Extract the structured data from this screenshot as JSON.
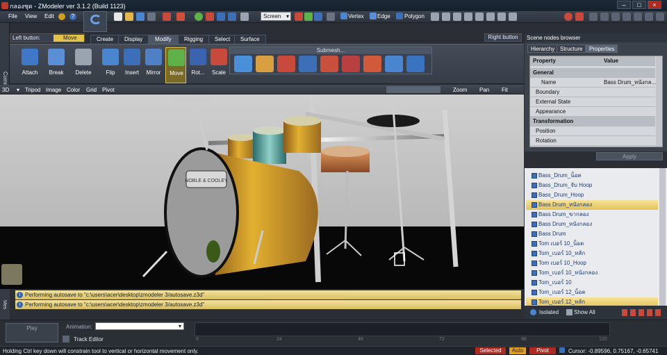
{
  "window": {
    "title": "กลองชุด - ZModeler ver 3.1.2 (Build 1123)",
    "controls": [
      "–",
      "□",
      "×"
    ]
  },
  "menu": [
    "File",
    "View",
    "Edit"
  ],
  "toolbar_top": {
    "screen_select": "Screen",
    "vertex": "Vertex",
    "edge": "Edge",
    "polygon": "Polygon"
  },
  "left_button": {
    "label": "Left button:",
    "value": "Move"
  },
  "right_button": {
    "label": "Right button"
  },
  "tabs": [
    "Create",
    "Display",
    "Modify",
    "Rigging",
    "Select",
    "Surface"
  ],
  "active_tab": "Modify",
  "tools": [
    {
      "label": "Attach",
      "icon": "attach-icon",
      "color": "#3f78c8"
    },
    {
      "label": "Break",
      "icon": "break-icon",
      "color": "#5a8fd6"
    },
    {
      "label": "Delete",
      "icon": "trash-icon",
      "color": "#9aa4b0"
    },
    {
      "label": "Flip",
      "icon": "flip-icon",
      "color": "#4a86d0"
    },
    {
      "label": "Insert",
      "icon": "insert-icon",
      "color": "#3d6fb8"
    },
    {
      "label": "Mirror",
      "icon": "mirror-icon",
      "color": "#4f7fc4"
    },
    {
      "label": "Move",
      "icon": "move-icon",
      "color": "#5fb24a"
    },
    {
      "label": "Rot...",
      "icon": "rotate-icon",
      "color": "#3a64b0"
    },
    {
      "label": "Scale",
      "icon": "scale-icon",
      "color": "#c84a3c"
    }
  ],
  "submesh": {
    "label": "Submesh...",
    "icons": [
      "#4a90d8",
      "#d8a040",
      "#c84a3c",
      "#3d6fb8",
      "#c8503c",
      "#b84040",
      "#d05a3a",
      "#4a86d0",
      "#3a74c0"
    ]
  },
  "view": {
    "mode": "3D",
    "items": [
      "Tripod",
      "Image",
      "Color",
      "Grid",
      "Pivot"
    ],
    "zoom": "Zoom",
    "pan": "Pan",
    "fit": "Fit"
  },
  "messages": [
    "Performing autosave to \"c:\\users\\acer\\desktop\\zmodeler 3/autosave.z3d\"",
    "Performing autosave to \"c:\\users\\acer\\desktop\\zmodeler 3/autosave.z3d\""
  ],
  "side": {
    "commands": "Commands",
    "mes": "Mes"
  },
  "scene": {
    "title": "Scene nodes browser",
    "tabs": [
      "Hierarchy",
      "Structure",
      "Properties"
    ],
    "active": "Properties"
  },
  "properties": {
    "col_property": "Property",
    "col_value": "Value",
    "rows": [
      {
        "k": "General",
        "hd": true
      },
      {
        "k": "Name",
        "v": "Bass Drum_หนังกล..."
      },
      {
        "k": "Boundary"
      },
      {
        "k": "External State"
      },
      {
        "k": "Appearance"
      },
      {
        "k": "Transformation",
        "hd": true
      },
      {
        "k": "Position"
      },
      {
        "k": "Rotation"
      }
    ],
    "apply": "Apply"
  },
  "nodes": [
    "Bass_Drum_น็อต",
    "Bass_Drum_จับ Hoop",
    "Bass_Drum_Hoop",
    "Bass Drum_หนังกลอง",
    "Bass Drum_ขากลอง",
    "Bass Drum_หนังกลอง",
    "Bass Drum",
    "Tom เบอร์ 10_น็อต",
    "Tom_เบอร์ 10_หลัก",
    "Tom เบอร์ 10_Hoop",
    "Tom_เบอร์ 10_หนังกลอง",
    "Tom_เบอร์ 10",
    "Tom_เบอร์ 12_น็อต",
    "Tom_เบอร์ 12_หลัก"
  ],
  "selected_node_index": 3,
  "node_footer": {
    "isolated": "Isolated",
    "show_all": "Show All"
  },
  "animation": {
    "play": "Play",
    "label": "Animation:",
    "track_editor": "Track Editor",
    "ticks": [
      "0",
      "24",
      "48",
      "72",
      "96",
      "120"
    ]
  },
  "bass_drum_brand": "NOBLE & COOLEY",
  "status": {
    "hint": "Holding Ctrl key down will constrain tool to vertical or horizontal movement only.",
    "selected": "Selected",
    "auto": "Auto",
    "pivot": "Pivot",
    "cursor": "Cursor: -0.89596, 0.75167, -0.65741"
  }
}
